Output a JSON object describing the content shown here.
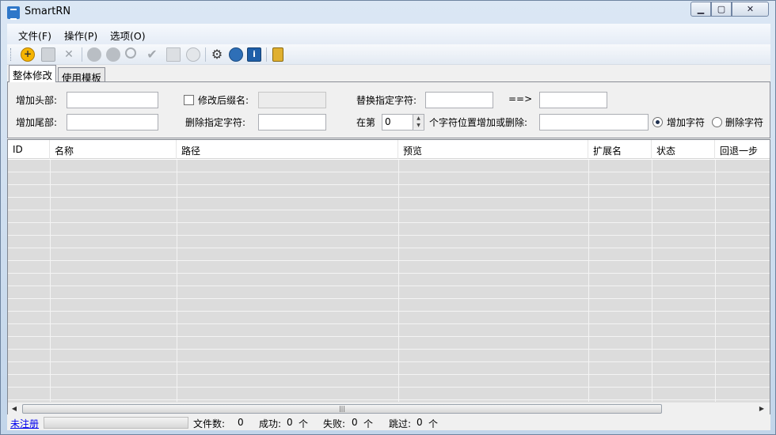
{
  "window": {
    "title": "SmartRN"
  },
  "menu": [
    "文件(F)",
    "操作(P)",
    "选项(O)"
  ],
  "toolbar_icons": [
    "add-icon",
    "save-icon",
    "delete-icon",
    "back-icon",
    "forward-icon",
    "search-icon",
    "check-icon",
    "grid-icon",
    "clock-icon",
    "settings-icon",
    "home-icon",
    "info-icon",
    "lock-icon"
  ],
  "tabs": [
    "整体修改",
    "使用模板"
  ],
  "form": {
    "add_head_label": "增加头部:",
    "add_tail_label": "增加尾部:",
    "modify_ext_label": "修改后缀名:",
    "delete_chars_label": "删除指定字符:",
    "replace_label": "替换指定字符:",
    "arrow_label": "==>",
    "at_pos_label": "在第",
    "position_value": "0",
    "pos_suffix_label": "个字符位置增加或删除:",
    "radio_add": "增加字符",
    "radio_delete": "删除字符"
  },
  "grid": {
    "columns": [
      "ID",
      "名称",
      "路径",
      "预览",
      "扩展名",
      "状态",
      "回退一步"
    ]
  },
  "status": {
    "register_link": "未注册",
    "file_count_label": "文件数:",
    "file_count": "0",
    "success_label": "成功:",
    "success_count": "0",
    "success_unit": "个",
    "fail_label": "失败:",
    "fail_count": "0",
    "fail_unit": "个",
    "skip_label": "跳过:",
    "skip_count": "0",
    "skip_unit": "个"
  },
  "colors": {
    "accent": "#2f77c9",
    "grid_row": "#dcdcdc",
    "link": "#0000ee"
  }
}
